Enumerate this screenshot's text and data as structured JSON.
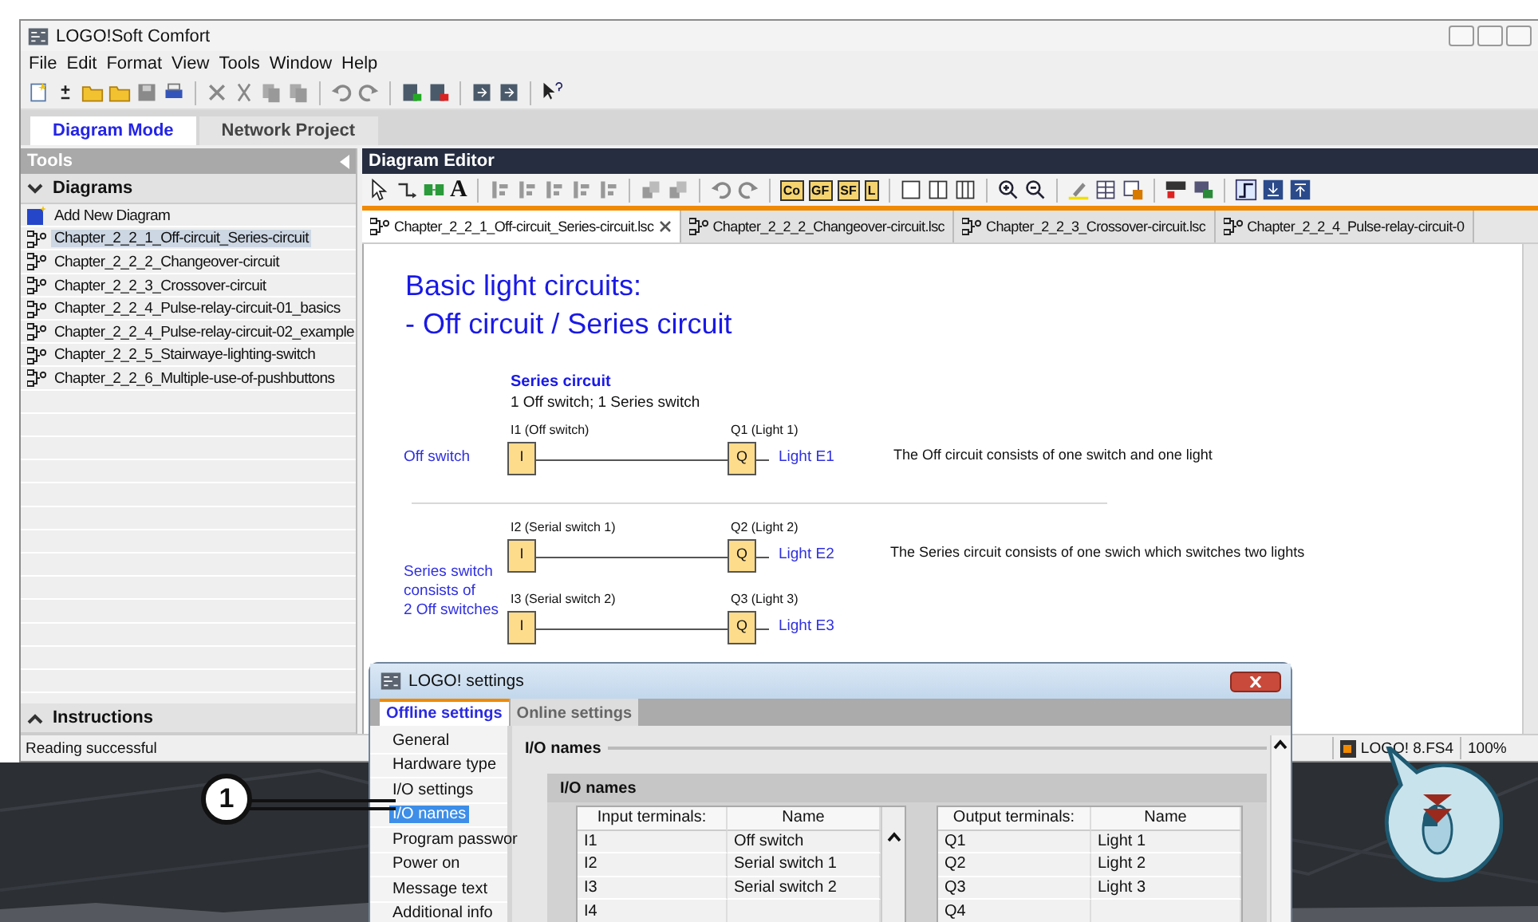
{
  "window": {
    "title": "LOGO!Soft Comfort"
  },
  "menu": [
    "File",
    "Edit",
    "Format",
    "View",
    "Tools",
    "Window",
    "Help"
  ],
  "mode_tabs": [
    {
      "label": "Diagram Mode",
      "selected": true
    },
    {
      "label": "Network Project",
      "selected": false
    }
  ],
  "tools_panel": {
    "title": "Tools",
    "section": "Diagrams",
    "footer": "Instructions",
    "items": [
      {
        "kind": "add",
        "label": "Add New Diagram",
        "selected": false
      },
      {
        "kind": "diagram",
        "label": "Chapter_2_2_1_Off-circuit_Series-circuit",
        "selected": true
      },
      {
        "kind": "diagram",
        "label": "Chapter_2_2_2_Changeover-circuit",
        "selected": false
      },
      {
        "kind": "diagram",
        "label": "Chapter_2_2_3_Crossover-circuit",
        "selected": false
      },
      {
        "kind": "diagram",
        "label": "Chapter_2_2_4_Pulse-relay-circuit-01_basics",
        "selected": false
      },
      {
        "kind": "diagram",
        "label": "Chapter_2_2_4_Pulse-relay-circuit-02_example",
        "selected": false
      },
      {
        "kind": "diagram",
        "label": "Chapter_2_2_5_Stairwaye-lighting-switch",
        "selected": false
      },
      {
        "kind": "diagram",
        "label": "Chapter_2_2_6_Multiple-use-of-pushbuttons",
        "selected": false
      }
    ]
  },
  "editor": {
    "title": "Diagram Editor",
    "text_tool": "A",
    "letter_buttons": [
      "Co",
      "GF",
      "SF",
      "L"
    ],
    "tabs": [
      {
        "label": "Chapter_2_2_1_Off-circuit_Series-circuit.lsc",
        "selected": true
      },
      {
        "label": "Chapter_2_2_2_Changeover-circuit.lsc",
        "selected": false
      },
      {
        "label": "Chapter_2_2_3_Crossover-circuit.lsc",
        "selected": false
      },
      {
        "label": "Chapter_2_2_4_Pulse-relay-circuit-0",
        "selected": false
      }
    ],
    "canvas": {
      "title_lines": [
        "Basic light circuits:",
        "- Off circuit / Series circuit"
      ],
      "heading": "Series circuit",
      "subheading": "1 Off switch; 1 Series switch",
      "groups": [
        {
          "label_lines": [
            "Off switch"
          ],
          "description": "The Off circuit consists of one switch and one light",
          "rungs": [
            {
              "input_label": "I1 (Off switch)",
              "input_symbol": "I",
              "output_label": "Q1 (Light 1)",
              "output_symbol": "Q",
              "light": "Light E1"
            }
          ]
        },
        {
          "label_lines": [
            "Series switch",
            "consists of",
            "2 Off switches"
          ],
          "description": "The Series circuit consists of one swich which switches two lights",
          "rungs": [
            {
              "input_label": "I2 (Serial switch 1)",
              "input_symbol": "I",
              "output_label": "Q2 (Light 2)",
              "output_symbol": "Q",
              "light": "Light E2"
            },
            {
              "input_label": "I3 (Serial switch 2)",
              "input_symbol": "I",
              "output_label": "Q3 (Light 3)",
              "output_symbol": "Q",
              "light": "Light E3"
            }
          ]
        }
      ]
    }
  },
  "status_bar": {
    "message": "Reading successful",
    "device": "LOGO! 8.FS4",
    "zoom": "100%"
  },
  "dialog": {
    "title": "LOGO! settings",
    "tabs": [
      {
        "label": "Offline settings",
        "selected": true
      },
      {
        "label": "Online settings",
        "selected": false
      }
    ],
    "nav": [
      {
        "label": "General",
        "selected": false
      },
      {
        "label": "Hardware type",
        "selected": false
      },
      {
        "label": "I/O settings",
        "selected": false
      },
      {
        "label": "I/O names",
        "selected": true
      },
      {
        "label": "Program passwor",
        "selected": false
      },
      {
        "label": "Power on",
        "selected": false
      },
      {
        "label": "Message text",
        "selected": false
      },
      {
        "label": "Additional info",
        "selected": false
      }
    ],
    "section": "I/O names",
    "subsection": "I/O names",
    "inputs": {
      "columns": [
        "Input terminals:",
        "Name"
      ],
      "rows": [
        [
          "I1",
          "Off switch"
        ],
        [
          "I2",
          "Serial switch 1"
        ],
        [
          "I3",
          "Serial switch 2"
        ],
        [
          "I4"
        ]
      ]
    },
    "outputs": {
      "columns": [
        "Output terminals:",
        "Name"
      ],
      "rows": [
        [
          "Q1",
          "Light 1"
        ],
        [
          "Q2",
          "Light 2"
        ],
        [
          "Q3",
          "Light 3"
        ],
        [
          "Q4"
        ]
      ]
    }
  },
  "callout": {
    "number": "1"
  }
}
